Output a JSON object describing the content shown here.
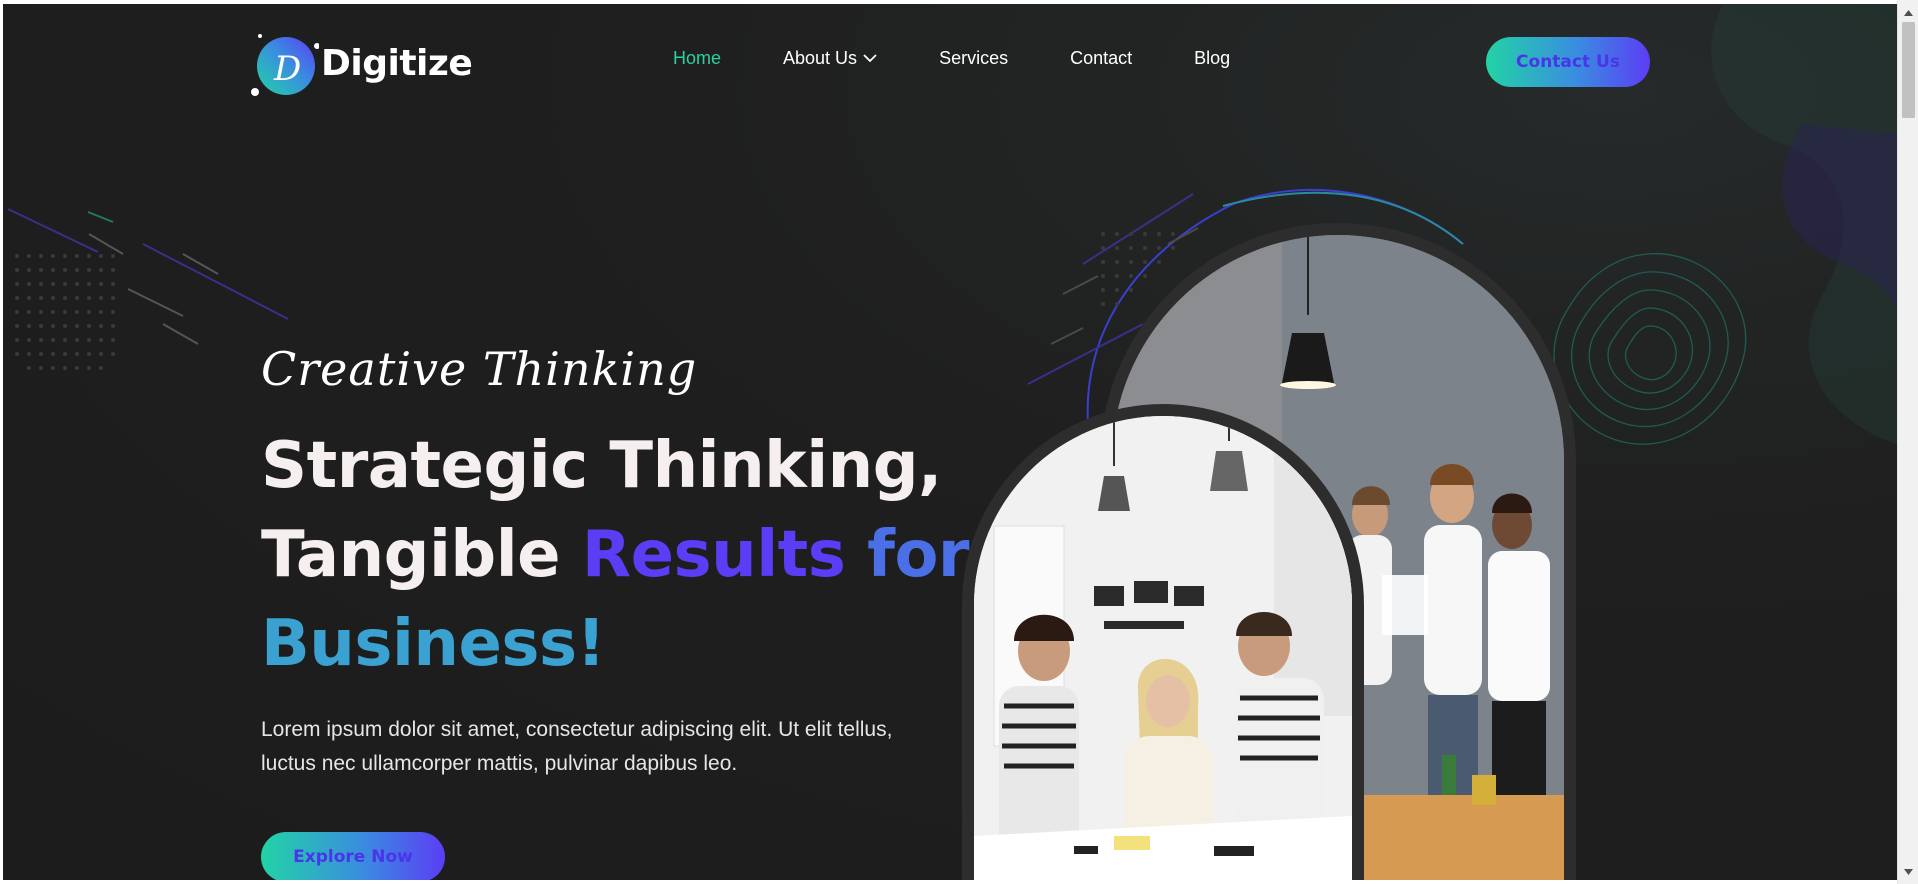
{
  "brand": {
    "name": "Digitize",
    "logo_letter": "D"
  },
  "nav": {
    "items": [
      {
        "label": "Home",
        "active": true
      },
      {
        "label": "About Us",
        "has_dropdown": true
      },
      {
        "label": "Services"
      },
      {
        "label": "Contact"
      },
      {
        "label": "Blog"
      }
    ],
    "cta_label": "Contact Us"
  },
  "hero": {
    "tagline": "Creative Thinking",
    "headline_line1": "Strategic Thinking,",
    "headline_line2_plain": "Tangible",
    "headline_line2_accent1": "Results",
    "headline_line2_accent2": "for",
    "headline_line3_accent": "Business!",
    "lead": "Lorem ipsum dolor sit amet, consectetur adipiscing elit. Ut elit tellus, luctus nec ullamcorper mattis, pulvinar dapibus leo.",
    "cta_label": "Explore Now"
  },
  "icons": {
    "logo": "logo-d-circle-icon",
    "dropdown": "chevron-down-icon",
    "scroll_up": "scroll-up-arrow-icon",
    "scroll_down": "scroll-down-arrow-icon"
  },
  "colors": {
    "background": "#1e1e1e",
    "accent_green": "#22d3a5",
    "accent_purple": "#5b3df5",
    "nav_active": "#2ad2a0"
  }
}
